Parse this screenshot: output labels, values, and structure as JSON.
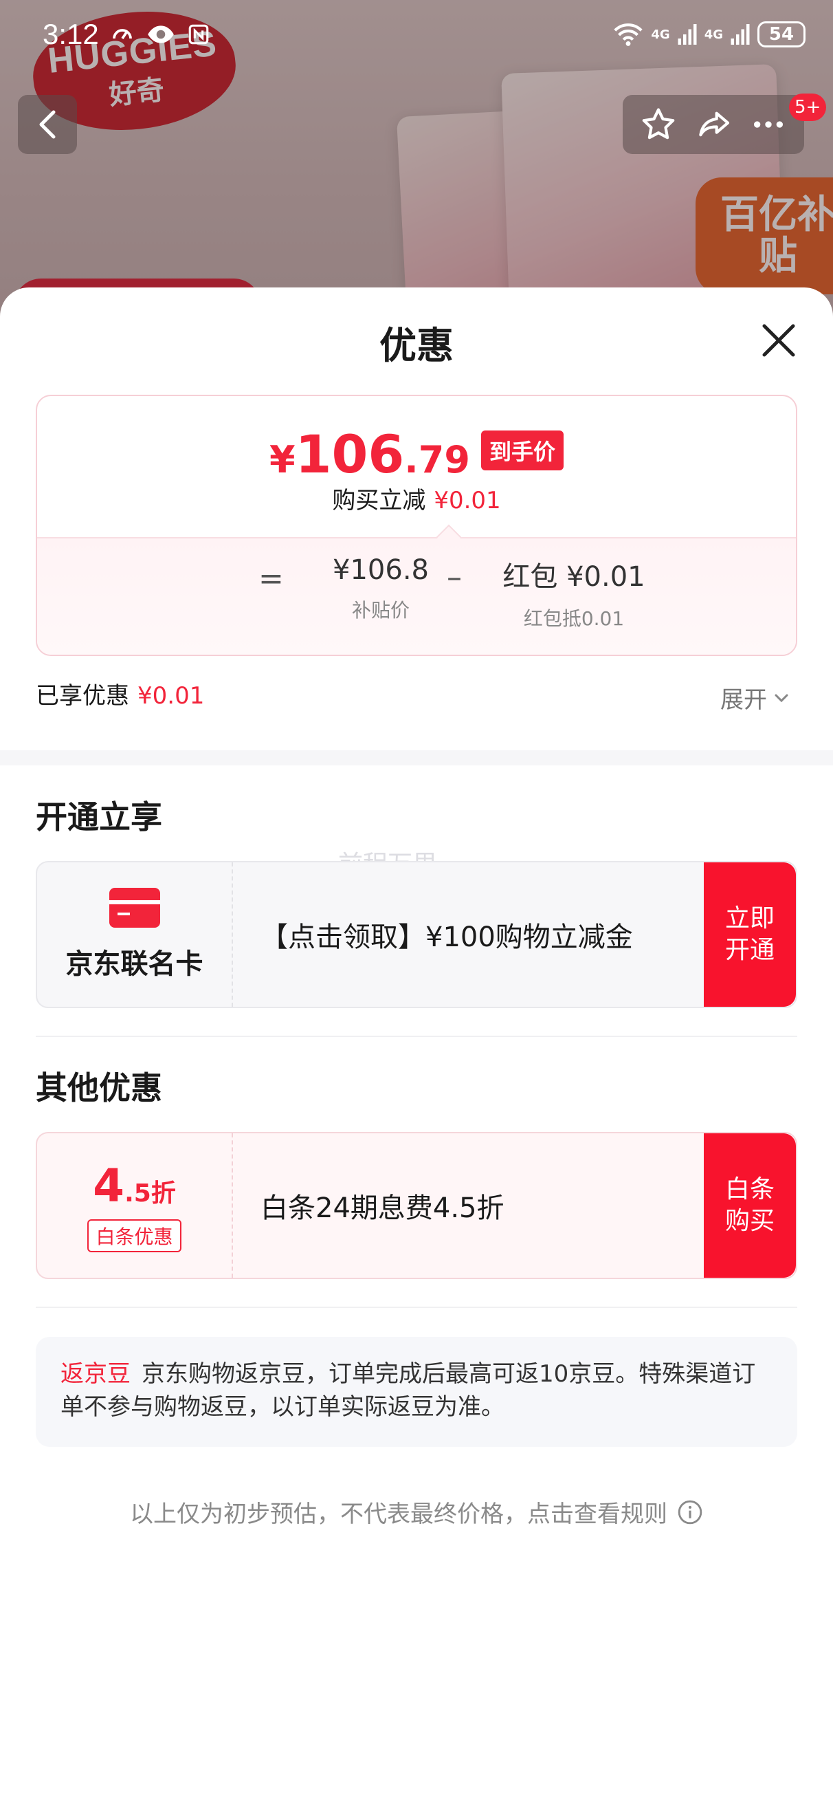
{
  "status_bar": {
    "time": "3:12",
    "battery": "54",
    "signal_1": "4G",
    "signal_2": "4G",
    "wifi_label": "6"
  },
  "background": {
    "brand_name": "HUGGIES",
    "brand_name_cn": "好奇",
    "promo_tag": "百亿补贴",
    "badge_count": "5+"
  },
  "sheet": {
    "title": "优惠",
    "price": {
      "yen": "¥",
      "integer": "106",
      "decimal": ".79",
      "badge": "到手价",
      "sub_label": "购买立减",
      "sub_value": "¥0.01"
    },
    "calc": {
      "equals": "=",
      "subsidy_value": "¥106.8",
      "subsidy_label": "补贴价",
      "minus": "–",
      "redpacket_value": "红包 ¥0.01",
      "redpacket_label": "红包抵0.01"
    },
    "enjoyed_label": "已享优惠",
    "enjoyed_value": "¥0.01",
    "expand_label": "展开"
  },
  "open_section": {
    "title": "开通立享",
    "card_name": "京东联名卡",
    "offer_text": "【点击领取】¥100购物立减金",
    "button_label_1": "立即",
    "button_label_2": "开通"
  },
  "other_section": {
    "title": "其他优惠",
    "discount_big": "4",
    "discount_small": ".5折",
    "discount_tag": "白条优惠",
    "offer_text": "白条24期息费4.5折",
    "button_label_1": "白条",
    "button_label_2": "购买"
  },
  "note": {
    "label": "返京豆",
    "text": "京东购物返京豆，订单完成后最高可返10京豆。特殊渠道订单不参与购物返豆，以订单实际返豆为准。"
  },
  "footer": {
    "text": "以上仅为初步预估，不代表最终价格，点击查看规则"
  },
  "watermark": "前程万里",
  "colors": {
    "accent": "#f2243a",
    "button": "#f8132d"
  }
}
